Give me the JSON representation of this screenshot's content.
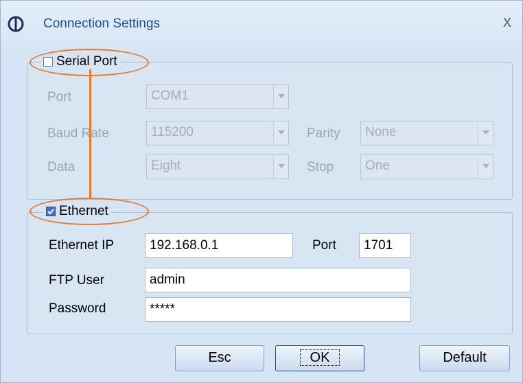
{
  "window": {
    "title": "Connection Settings",
    "close_glyph": "x",
    "icon": "app-logo-icon"
  },
  "serial": {
    "legend": "Serial Port",
    "checked": false,
    "port_label": "Port",
    "port_value": "COM1",
    "baud_label": "Baud Rate",
    "baud_value": "115200",
    "parity_label": "Parity",
    "parity_value": "None",
    "data_label": "Data",
    "data_value": "Eight",
    "stop_label": "Stop",
    "stop_value": "One"
  },
  "ethernet": {
    "legend": "Ethernet",
    "checked": true,
    "ip_label": "Ethernet IP",
    "ip_value": "192.168.0.1",
    "port_label": "Port",
    "port_value": "1701",
    "ftp_user_label": "FTP User",
    "ftp_user_value": "admin",
    "password_label": "Password",
    "password_value": "*****"
  },
  "buttons": {
    "esc": "Esc",
    "ok": "OK",
    "default": "Default"
  },
  "colors": {
    "annotation": "#e87a2a",
    "title": "#1f4f8a",
    "checkbox_checked": "#4a72c2"
  }
}
